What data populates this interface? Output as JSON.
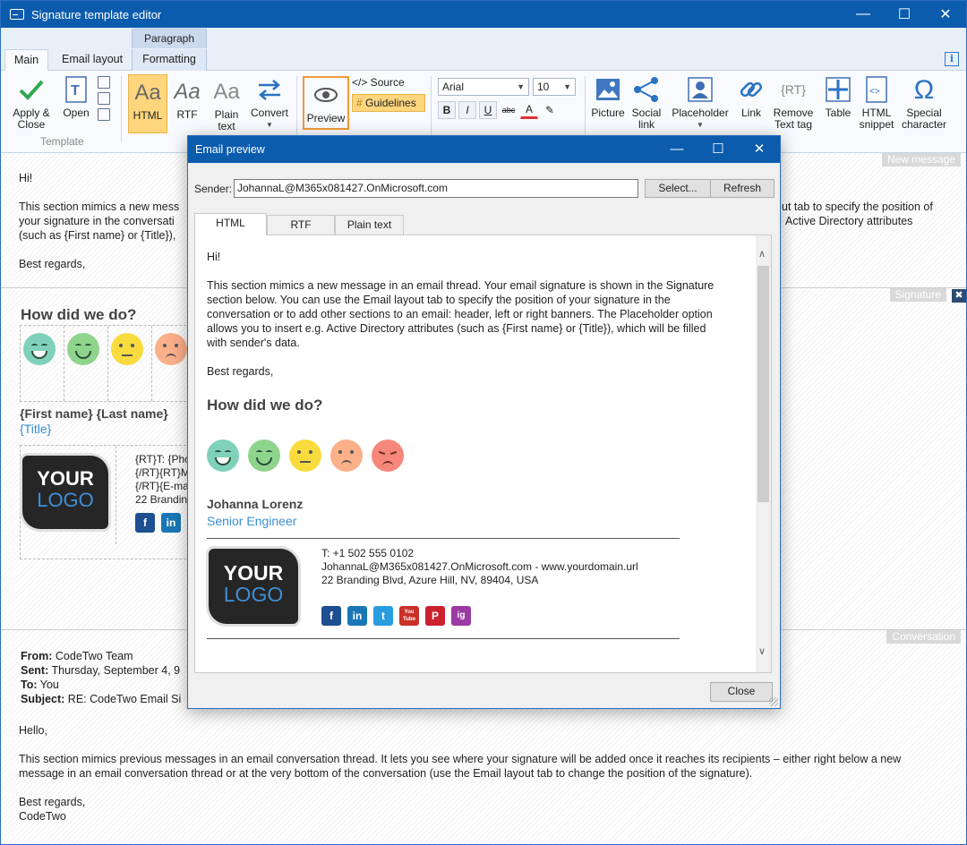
{
  "window": {
    "title": "Signature template editor"
  },
  "ribbon": {
    "context_group": "Paragraph",
    "tabs": [
      "Main",
      "Email layout",
      "Formatting"
    ],
    "info": "i",
    "apply_close": "Apply &\nClose",
    "open": "Open",
    "group_template": "Template",
    "html": "HTML",
    "rtf": "RTF",
    "plain_text": "Plain\ntext",
    "convert": "Convert",
    "preview": "Preview",
    "source": "</> Source",
    "guidelines": "Guidelines",
    "font": "Arial",
    "font_size": "10",
    "bold": "B",
    "italic": "I",
    "underline": "U",
    "strike": "abc",
    "font_color": "A",
    "picture": "Picture",
    "social_link": "Social\nlink",
    "placeholder": "Placeholder",
    "link": "Link",
    "remove_text_tag": "Remove\nText tag",
    "table": "Table",
    "html_snippet": "HTML\nsnippet",
    "special_character": "Special\ncharacter",
    "aa": "Aa",
    "rt_icon": "{RT}"
  },
  "editor": {
    "labels": {
      "new_message": "New message",
      "signature": "Signature",
      "conversation": "Conversation"
    },
    "new_message": {
      "hi": "Hi!",
      "line1": "This section mimics a new mess",
      "line2": "your signature in the conversati",
      "line3": "(such as {First name} or {Title}),",
      "right1": "ut tab to specify the position of",
      "right2": "Active Directory attributes",
      "regards": "Best regards,"
    },
    "signature": {
      "heading": "How did we do?",
      "name": "{First name} {Last name}",
      "title": "{Title}",
      "rt1": "{RT}T: {Pho",
      "rt2": "{/RT}{RT}M",
      "rt3": "{/RT}{E-ma",
      "rt4": "22 Brandin",
      "logo1": "YOUR",
      "logo2": "LOGO"
    },
    "conversation": {
      "from_label": "From:",
      "from": " CodeTwo Team",
      "sent_label": "Sent:",
      "sent": " Thursday, September 4, 9",
      "to_label": "To:",
      "to": " You",
      "subject_label": "Subject:",
      "subject": " RE: CodeTwo Email Si",
      "hello": "Hello,",
      "body1": "This section mimics previous messages in an email conversation thread. It lets you see where your signature will be added once it reaches its recipients – either right below a new",
      "body2": "message in an email conversation thread or at the very bottom of the conversation (use the Email layout tab to change the position of the signature).",
      "regards": "Best regards,",
      "signoff": "CodeTwo"
    }
  },
  "dialog": {
    "title": "Email preview",
    "sender_label": "Sender:",
    "sender_value": "JohannaL@M365x081427.OnMicrosoft.com",
    "select": "Select...",
    "refresh": "Refresh",
    "tabs": [
      "HTML",
      "RTF",
      "Plain text"
    ],
    "close": "Close",
    "preview": {
      "hi": "Hi!",
      "p1": "This section mimics a new message in an email thread. Your email signature is shown in the Signature",
      "p2": "section below. You can use the Email layout tab to specify the position of your signature in the",
      "p3": "conversation or to add other sections to an email: header, left or right banners. The Placeholder option",
      "p4": "allows you to insert e.g. Active Directory attributes (such as {First name} or {Title}), which will be filled",
      "p5": "with sender's data.",
      "regards": "Best regards,",
      "heading": "How did we do?",
      "name": "Johanna Lorenz",
      "title": "Senior Engineer",
      "phone": "T: +1 502 555 0102",
      "email": "JohannaL@M365x081427.OnMicrosoft.com - www.yourdomain.url",
      "address": "22 Branding Blvd, Azure Hill, NV, 89404, USA",
      "logo1": "YOUR",
      "logo2": "LOGO"
    }
  },
  "social": [
    "f",
    "in",
    "t",
    "You Tube",
    "P",
    "ig"
  ],
  "colors": {
    "accent": "#0b5cad",
    "link": "#3a8fd0",
    "guidelines": "#ffd67e"
  }
}
